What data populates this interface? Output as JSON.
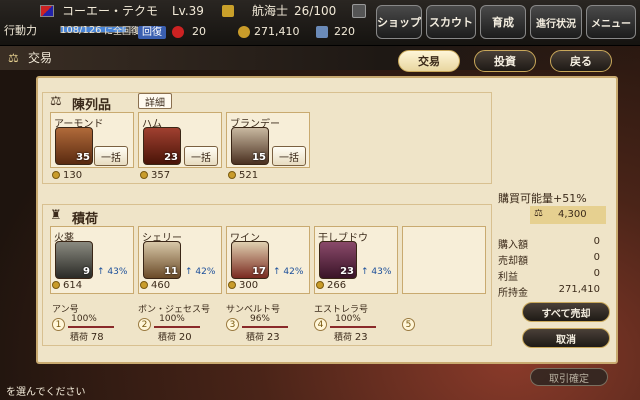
{
  "topbar": {
    "name": "コーエー・テクモ",
    "level": "Lv.39",
    "rank": "航海士",
    "rank_exp": "26/100",
    "action_label": "行動力",
    "action_value": "108/126",
    "action_note": "に全回復",
    "action_fill": 0.857,
    "recover_label": "回復",
    "gems": "20",
    "gold": "271,410",
    "books": "220",
    "buttons": [
      "ショップ",
      "スカウト",
      "育成",
      "進行状況",
      "メニュー"
    ]
  },
  "title": "交易",
  "tabs": [
    {
      "label": "交易",
      "active": true
    },
    {
      "label": "投資",
      "active": false
    },
    {
      "label": "戻る",
      "active": false
    }
  ],
  "display": {
    "title": "陳列品",
    "detail_label": "詳細",
    "bulk_label": "一括",
    "items": [
      {
        "name": "アーモンド",
        "qty": "35",
        "price": "130"
      },
      {
        "name": "ハム",
        "qty": "23",
        "price": "357"
      },
      {
        "name": "ブランデー",
        "qty": "15",
        "price": "521"
      }
    ]
  },
  "cargo": {
    "title": "積荷",
    "items": [
      {
        "name": "火薬",
        "qty": "9",
        "pct": "43%",
        "price": "614"
      },
      {
        "name": "シェリー",
        "qty": "11",
        "pct": "42%",
        "price": "460"
      },
      {
        "name": "ワイン",
        "qty": "17",
        "pct": "42%",
        "price": "300"
      },
      {
        "name": "干しブドウ",
        "qty": "23",
        "pct": "43%",
        "price": "266"
      }
    ]
  },
  "ships": [
    {
      "num": "1",
      "name": "アン号",
      "pct": "100%",
      "load_label": "積荷",
      "load": "78"
    },
    {
      "num": "2",
      "name": "ボン・ジェセス号",
      "pct": "100%",
      "load_label": "積荷",
      "load": "20"
    },
    {
      "num": "3",
      "name": "サンベルト号",
      "pct": "96%",
      "load_label": "積荷",
      "load": "23"
    },
    {
      "num": "4",
      "name": "エストレラ号",
      "pct": "100%",
      "load_label": "積荷",
      "load": "23"
    },
    {
      "num": "5",
      "name": "",
      "pct": "",
      "load_label": "",
      "load": ""
    }
  ],
  "summary": {
    "buy_capacity_label": "購買可能量+51%",
    "buy_capacity_value": "4,300",
    "purchase_label": "購入額",
    "purchase_value": "0",
    "sale_label": "売却額",
    "sale_value": "0",
    "profit_label": "利益",
    "profit_value": "0",
    "funds_label": "所持金",
    "funds_value": "271,410"
  },
  "actions": {
    "sell_all": "すべて売却",
    "cancel": "取消",
    "confirm": "取引確定"
  },
  "bottom_message": "を選んでください",
  "colors": {
    "panel": "#efe4c8",
    "accent": "#c9a85a",
    "pct_blue": "#1c4f9a"
  }
}
